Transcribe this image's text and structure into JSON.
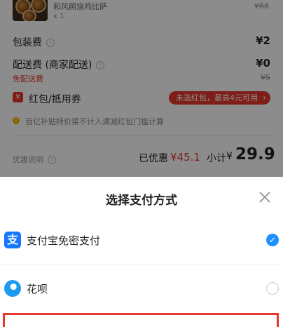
{
  "order": {
    "item": {
      "name": "和风照烧鸡比萨",
      "qty": "x 1",
      "original_price": "¥68"
    },
    "packaging": {
      "label": "包装费",
      "value": "¥2"
    },
    "delivery": {
      "label": "配送费 (商家配送)",
      "value": "¥0",
      "free_label": "免配送费",
      "old_value": "¥5"
    },
    "coupon": {
      "icon": "¥",
      "label": "红包/抵用券",
      "pill_text": "未选红包，最高4元可用"
    },
    "notice": {
      "icon": "!",
      "text": "百亿补贴特价菜不计入满减红包门槛计算"
    },
    "summary": {
      "discount_label": "优惠说明",
      "discount_prefix": "已优惠",
      "discount_amount": "¥45.1",
      "subtotal_prefix": "小计",
      "subtotal_yen": "¥",
      "subtotal_value": "29.9"
    }
  },
  "pay_sheet": {
    "title": "选择支付方式",
    "options": [
      {
        "label": "支付宝免密支付",
        "logo_text": "支",
        "selected": true
      },
      {
        "label": "花呗",
        "selected": false
      }
    ],
    "check_glyph": "✓"
  },
  "colors": {
    "accent": "#e8382d",
    "alipay": "#1677ff",
    "check": "#1e90ff"
  },
  "icons": [
    "help-icon",
    "coupon-icon",
    "notice-icon",
    "close-icon",
    "alipay-logo",
    "huabei-logo",
    "check-icon",
    "chevron-right-icon"
  ]
}
